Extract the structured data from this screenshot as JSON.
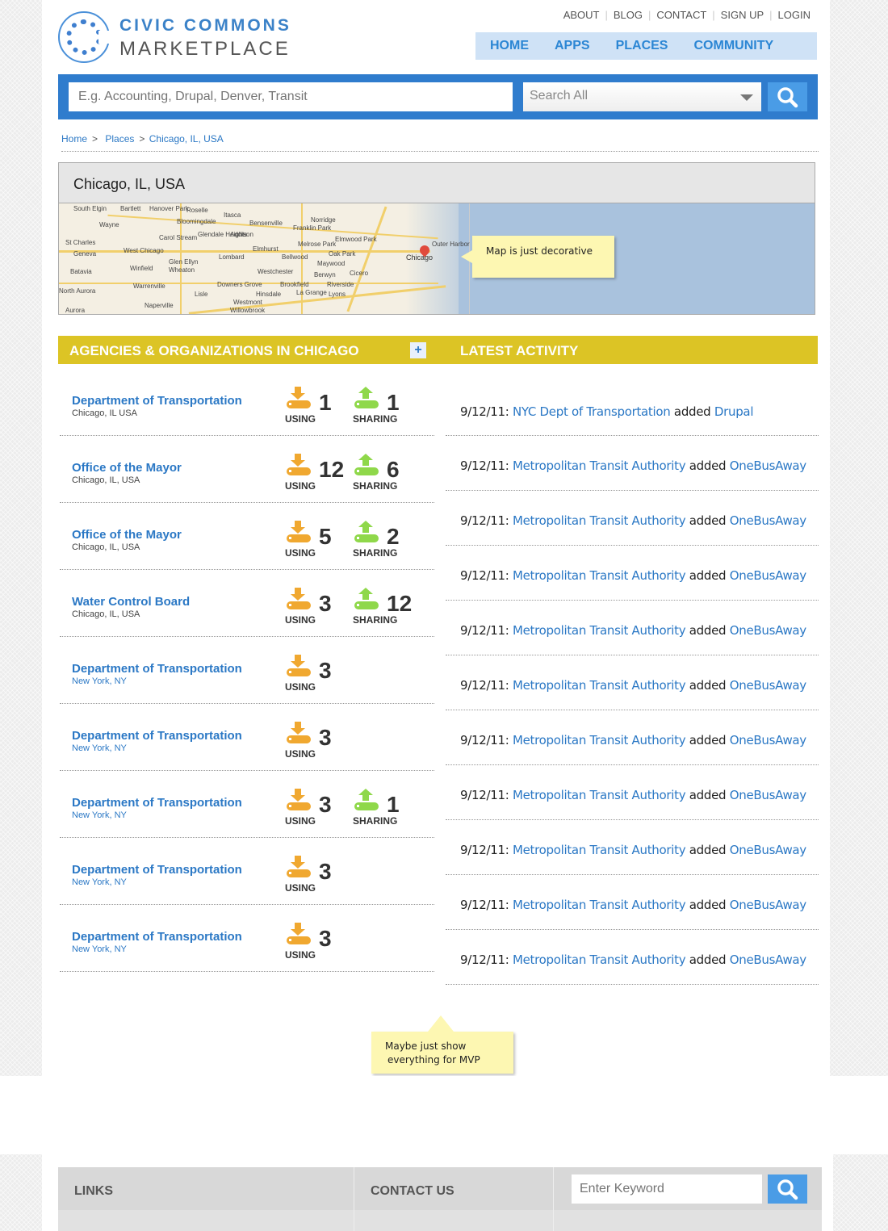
{
  "brand": {
    "line1": "CIVIC COMMONS",
    "line2": "MARKETPLACE"
  },
  "top_links": [
    "ABOUT",
    "BLOG",
    "CONTACT",
    "SIGN UP",
    "LOGIN"
  ],
  "main_nav": [
    "HOME",
    "APPS",
    "PLACES",
    "COMMUNITY"
  ],
  "search": {
    "placeholder": "E.g. Accounting, Drupal, Denver, Transit",
    "scope_value": "Search All"
  },
  "breadcrumb": [
    "Home",
    "Places",
    "Chicago, IL, USA"
  ],
  "place": {
    "title": "Chicago, IL, USA",
    "map_note": "Map is just decorative",
    "map_labels": [
      "South Elgin",
      "Bartlett",
      "Hanover Park",
      "Roselle",
      "Itasca",
      "Wayne",
      "Bloomingdale",
      "Bensenville",
      "Norridge",
      "Franklin Park",
      "St Charles",
      "Carol Stream",
      "Glendale Heights",
      "Addison",
      "Elmwood Park",
      "Geneva",
      "West Chicago",
      "Elmhurst",
      "Melrose Park",
      "Lombard",
      "Bellwood",
      "Oak Park",
      "Glen Ellyn",
      "Wheaton",
      "Maywood",
      "Batavia",
      "Winfield",
      "Westchester",
      "Berwyn",
      "Cicero",
      "Warrenville",
      "Downers Grove",
      "Brookfield",
      "Riverside",
      "North Aurora",
      "Lisle",
      "Hinsdale",
      "La Grange",
      "Lyons",
      "Naperville",
      "Westmont",
      "Willowbrook",
      "Aurora",
      "Outer Harbor",
      "Chicago"
    ]
  },
  "sections": {
    "agencies_title": "AGENCIES & ORGANIZATIONS IN CHICAGO",
    "add_label": "+",
    "activity_title": "LATEST ACTIVITY"
  },
  "labels": {
    "using": "USING",
    "sharing": "SHARING"
  },
  "agencies": [
    {
      "name": "Department of Transportation",
      "location": "Chicago, IL USA",
      "using": "1",
      "sharing": "1",
      "loc_blue": false
    },
    {
      "name": "Office of the Mayor",
      "location": "Chicago, IL, USA",
      "using": "12",
      "sharing": "6",
      "loc_blue": false
    },
    {
      "name": "Office of the Mayor",
      "location": "Chicago, IL, USA",
      "using": "5",
      "sharing": "2",
      "loc_blue": false
    },
    {
      "name": "Water Control Board",
      "location": "Chicago, IL, USA",
      "using": "3",
      "sharing": "12",
      "loc_blue": false
    },
    {
      "name": "Department of Transportation",
      "location": "New York, NY",
      "using": "3",
      "sharing": null,
      "loc_blue": true
    },
    {
      "name": "Department of Transportation",
      "location": "New York, NY",
      "using": "3",
      "sharing": null,
      "loc_blue": true
    },
    {
      "name": "Department of Transportation",
      "location": "New York, NY",
      "using": "3",
      "sharing": "1",
      "loc_blue": true
    },
    {
      "name": "Department of Transportation",
      "location": "New York, NY",
      "using": "3",
      "sharing": null,
      "loc_blue": true
    },
    {
      "name": "Department of Transportation",
      "location": "New York, NY",
      "using": "3",
      "sharing": null,
      "loc_blue": true
    }
  ],
  "activity": [
    {
      "date": "9/12/11:",
      "actor": "NYC Dept of Transportation",
      "verb": "added",
      "app": "Drupal"
    },
    {
      "date": "9/12/11:",
      "actor": "Metropolitan Transit Authority",
      "verb": "added",
      "app": "OneBusAway"
    },
    {
      "date": "9/12/11:",
      "actor": "Metropolitan Transit Authority",
      "verb": "added",
      "app": "OneBusAway"
    },
    {
      "date": "9/12/11:",
      "actor": "Metropolitan Transit Authority",
      "verb": "added",
      "app": "OneBusAway"
    },
    {
      "date": "9/12/11:",
      "actor": "Metropolitan Transit Authority",
      "verb": "added",
      "app": "OneBusAway"
    },
    {
      "date": "9/12/11:",
      "actor": "Metropolitan Transit Authority",
      "verb": "added",
      "app": "OneBusAway"
    },
    {
      "date": "9/12/11:",
      "actor": "Metropolitan Transit Authority",
      "verb": "added",
      "app": "OneBusAway"
    },
    {
      "date": "9/12/11:",
      "actor": "Metropolitan Transit Authority",
      "verb": "added",
      "app": "OneBusAway"
    },
    {
      "date": "9/12/11:",
      "actor": "Metropolitan Transit Authority",
      "verb": "added",
      "app": "OneBusAway"
    },
    {
      "date": "9/12/11:",
      "actor": "Metropolitan Transit Authority",
      "verb": "added",
      "app": "OneBusAway"
    },
    {
      "date": "9/12/11:",
      "actor": "Metropolitan Transit Authority",
      "verb": "added",
      "app": "OneBusAway"
    }
  ],
  "mvp_note": {
    "line1": "Maybe just show",
    "line2": "everything for MVP"
  },
  "footer": {
    "links_title": "LINKS",
    "contact_title": "CONTACT US",
    "search_placeholder": "Enter Keyword"
  },
  "colors": {
    "brand_blue": "#2f7ccd",
    "link_blue": "#2b78c5",
    "section_yellow": "#dcc425",
    "using_orange": "#f0a830",
    "sharing_green": "#8fd84a",
    "note_yellow": "#fdf7b2"
  },
  "icons": {
    "search": "magnifier-icon",
    "using": "download-tray-icon",
    "sharing": "upload-tray-icon",
    "map_marker": "map-pin-icon"
  }
}
